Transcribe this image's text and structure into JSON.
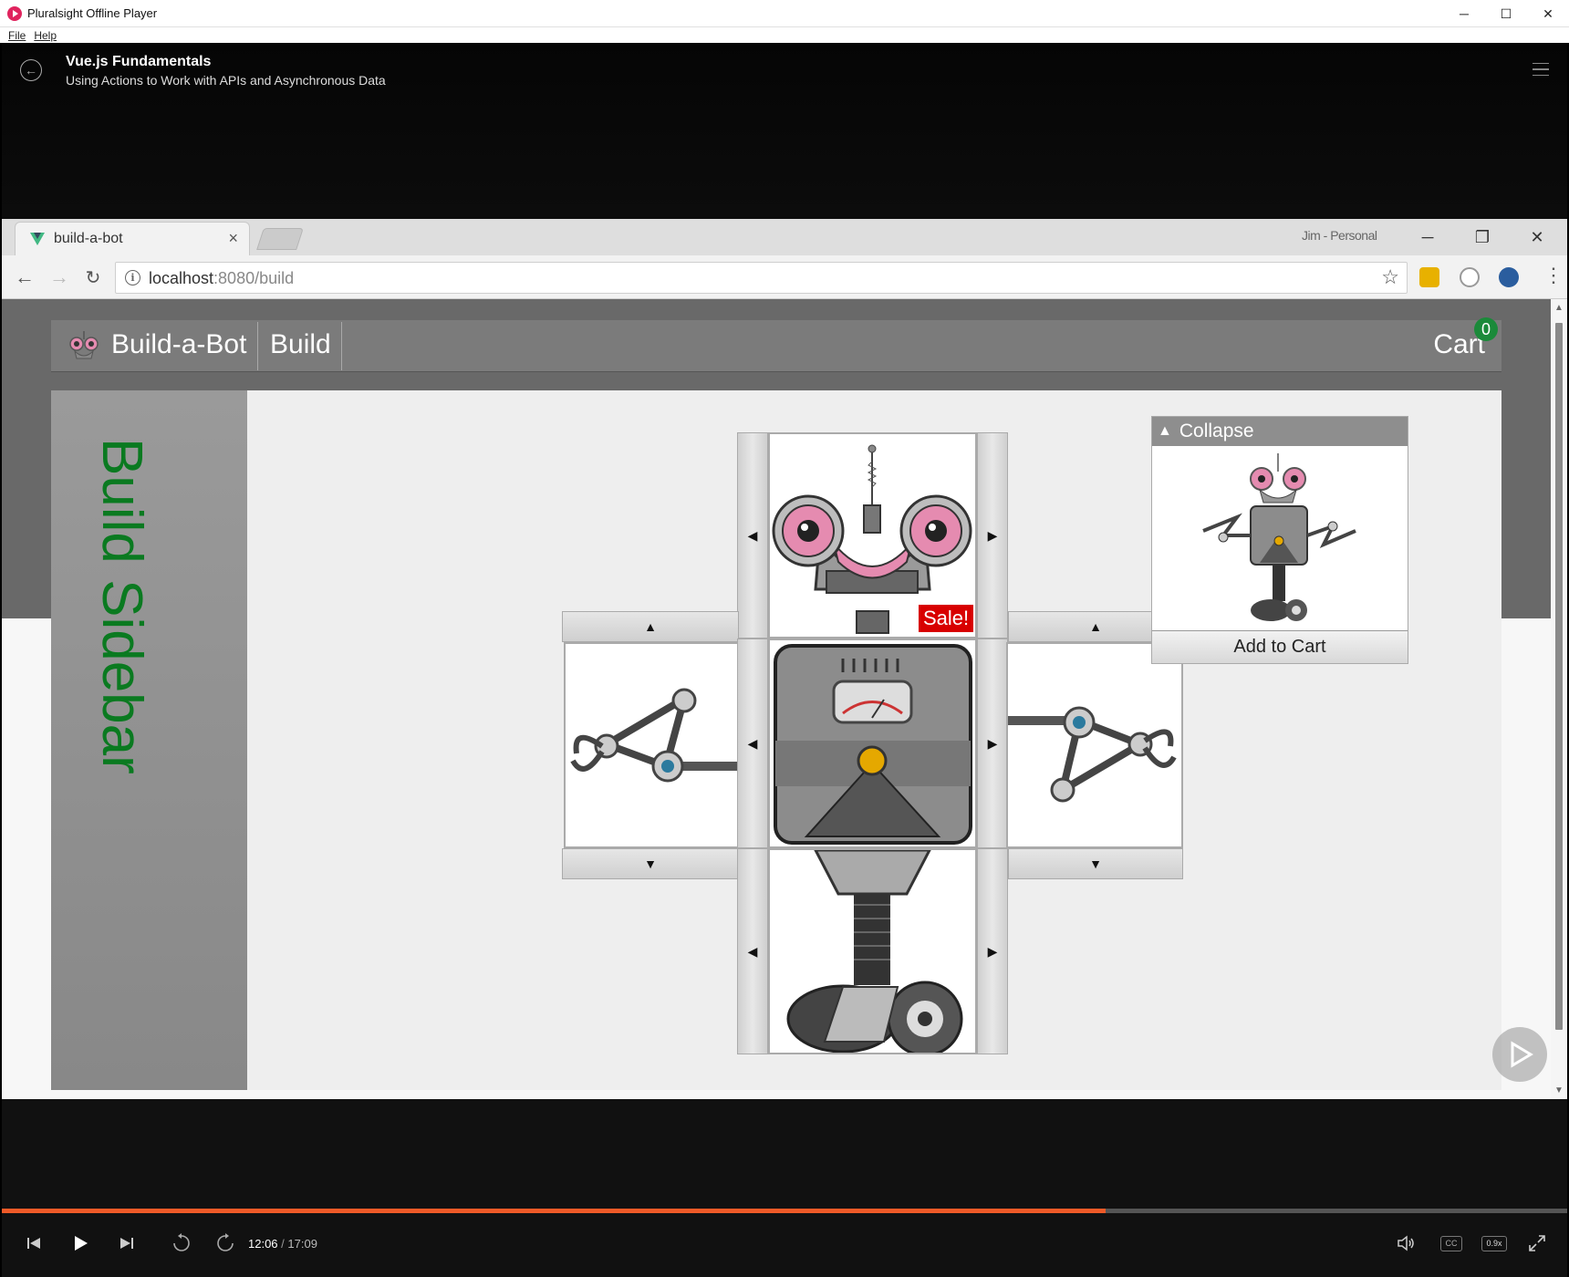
{
  "app": {
    "title": "Pluralsight Offline Player",
    "menu": [
      "File",
      "Help"
    ],
    "window_controls": [
      "─",
      "☐",
      "✕"
    ]
  },
  "player": {
    "course_title": "Vue.js Fundamentals",
    "module_title": "Using Actions to Work with APIs and Asynchronous Data",
    "current_time": "12:06",
    "separator": "/",
    "total_time": "17:09",
    "progress_fraction": 0.705,
    "speed": "0.9x",
    "cc": "CC",
    "colors": {
      "progress": "#f05a28",
      "background": "#111111"
    },
    "icons": [
      "back-icon",
      "menu-icon",
      "skip-previous-icon",
      "play-icon",
      "skip-next-icon",
      "rewind-10-icon",
      "forward-10-icon",
      "volume-icon",
      "fullscreen-icon"
    ]
  },
  "browser": {
    "tab_title": "build-a-bot",
    "tab_close": "×",
    "profile": "Jim - Personal",
    "url_host": "localhost",
    "url_path": ":8080/build",
    "window_controls": [
      "─",
      "❐",
      "✕"
    ]
  },
  "site": {
    "brand": "Build-a-Bot",
    "nav_build": "Build",
    "cart_label": "Cart",
    "cart_count": "0",
    "sidebar_text": "Build Sidebar",
    "sale_badge": "Sale!",
    "colors": {
      "sidebar_text": "#0a7a20",
      "cart_badge": "#1b8a3a",
      "sale": "#d80000"
    }
  },
  "builder_arrows": {
    "left": "◀",
    "right": "▶",
    "up": "▲",
    "down": "▼"
  },
  "preview": {
    "collapse_label": "Collapse",
    "collapse_icon": "▲",
    "add_to_cart": "Add to Cart"
  }
}
